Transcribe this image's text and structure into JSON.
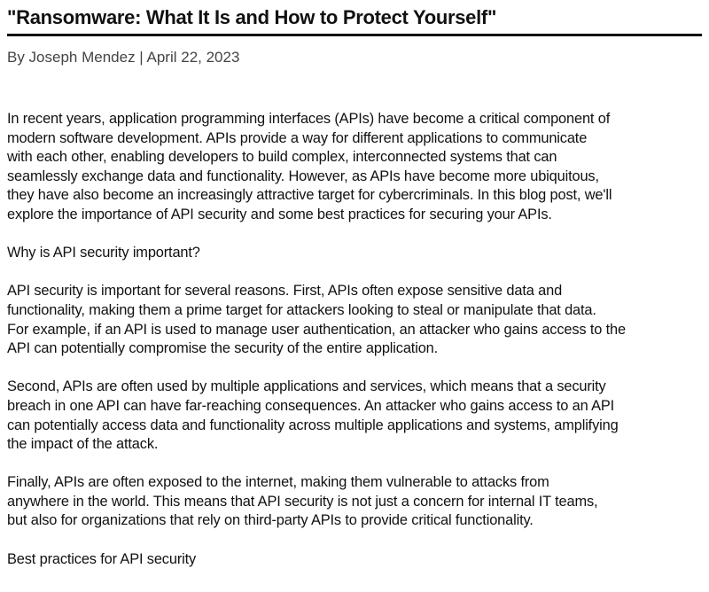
{
  "article": {
    "title": "\"Ransomware: What It Is and How to Protect Yourself\"",
    "byline": "By Joseph Mendez | April 22, 2023",
    "paragraphs": [
      [
        "In recent years, application programming interfaces (APIs) have become a critical component of",
        "modern software development. APIs provide a way for different applications to communicate",
        "with each other, enabling developers to build complex, interconnected systems that can",
        "seamlessly exchange data and functionality. However, as APIs have become more ubiquitous,",
        "they have also become an increasingly attractive target for cybercriminals. In this blog post, we'll",
        "explore the importance of API security and some best practices for securing your APIs."
      ],
      [
        "Why is API security important?"
      ],
      [
        "API security is important for several reasons. First, APIs often expose sensitive data and",
        "functionality, making them a prime target for attackers looking to steal or manipulate that data.",
        "For example, if an API is used to manage user authentication, an attacker who gains access to the",
        "API can potentially compromise the security of the entire application."
      ],
      [
        "Second, APIs are often used by multiple applications and services, which means that a security",
        "breach in one API can have far-reaching consequences. An attacker who gains access to an API",
        "can potentially access data and functionality across multiple applications and systems, amplifying",
        "the impact of the attack."
      ],
      [
        "Finally, APIs are often exposed to the internet, making them vulnerable to attacks from",
        "anywhere in the world. This means that API security is not just a concern for internal IT teams,",
        "but also for organizations that rely on third-party APIs to provide critical functionality."
      ],
      [
        "Best practices for API security"
      ]
    ]
  }
}
